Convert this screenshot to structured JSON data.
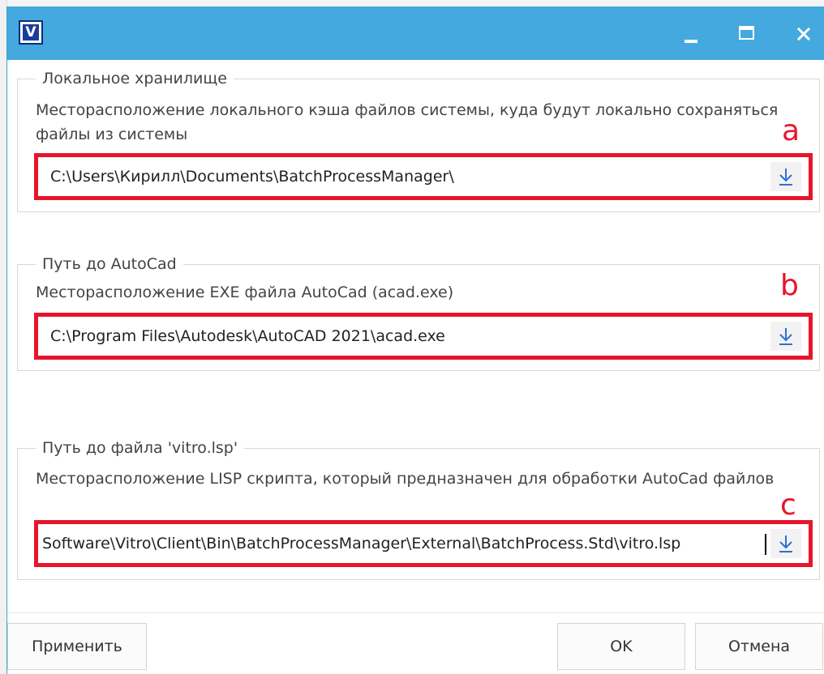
{
  "titlebar": {
    "app_icon_letter": "V",
    "minimize_icon": "minimize-icon",
    "maximize_icon": "maximize-icon",
    "close_icon": "close-icon"
  },
  "groups": [
    {
      "legend": "Локальное хранилище",
      "description": "Месторасположение локального кэша файлов системы, куда будут локально сохраняться файлы из системы",
      "value": "C:\\Users\\Кирилл\\Documents\\BatchProcessManager\\",
      "marker": "a",
      "browse_icon": "download-arrow-icon"
    },
    {
      "legend": "Путь до AutoCad",
      "description": "Месторасположение EXE файла AutoCad (acad.exe)",
      "value": "C:\\Program Files\\Autodesk\\AutoCAD 2021\\acad.exe",
      "marker": "b",
      "browse_icon": "download-arrow-icon"
    },
    {
      "legend": "Путь до файла 'vitro.lsp'",
      "description": "Месторасположение LISP скрипта, который предназначен для обработки AutoCad файлов",
      "value": "Software\\Vitro\\Client\\Bin\\BatchProcessManager\\External\\BatchProcess.Std\\vitro.lsp",
      "marker": "c",
      "browse_icon": "download-arrow-icon"
    }
  ],
  "footer": {
    "apply_label": "Применить",
    "ok_label": "OK",
    "cancel_label": "Отмена"
  },
  "colors": {
    "titlebar": "#43a9de",
    "annotation_red": "#e8152a",
    "browse_icon": "#2f6fd1"
  }
}
